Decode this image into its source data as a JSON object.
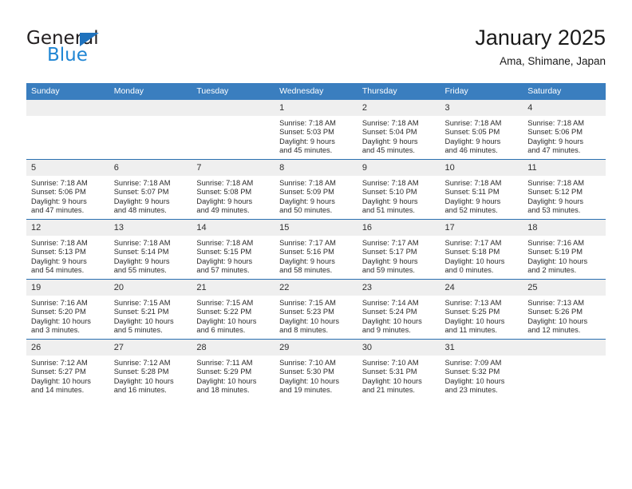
{
  "brand": {
    "name_part1": "General",
    "name_part2": "Blue",
    "triangle_color": "#1f72bd",
    "blue_color": "#2086d4"
  },
  "header": {
    "title": "January 2025",
    "subtitle": "Ama, Shimane, Japan"
  },
  "theme": {
    "header_row_bg": "#3a7ebf",
    "day_number_bg": "#efefef",
    "week_separator": "#2a6fb0"
  },
  "weekday_headers": [
    "Sunday",
    "Monday",
    "Tuesday",
    "Wednesday",
    "Thursday",
    "Friday",
    "Saturday"
  ],
  "weeks": [
    [
      {
        "day": "",
        "empty": true
      },
      {
        "day": "",
        "empty": true
      },
      {
        "day": "",
        "empty": true
      },
      {
        "day": "1",
        "sunrise": "Sunrise: 7:18 AM",
        "sunset": "Sunset: 5:03 PM",
        "daylight1": "Daylight: 9 hours",
        "daylight2": "and 45 minutes."
      },
      {
        "day": "2",
        "sunrise": "Sunrise: 7:18 AM",
        "sunset": "Sunset: 5:04 PM",
        "daylight1": "Daylight: 9 hours",
        "daylight2": "and 45 minutes."
      },
      {
        "day": "3",
        "sunrise": "Sunrise: 7:18 AM",
        "sunset": "Sunset: 5:05 PM",
        "daylight1": "Daylight: 9 hours",
        "daylight2": "and 46 minutes."
      },
      {
        "day": "4",
        "sunrise": "Sunrise: 7:18 AM",
        "sunset": "Sunset: 5:06 PM",
        "daylight1": "Daylight: 9 hours",
        "daylight2": "and 47 minutes."
      }
    ],
    [
      {
        "day": "5",
        "sunrise": "Sunrise: 7:18 AM",
        "sunset": "Sunset: 5:06 PM",
        "daylight1": "Daylight: 9 hours",
        "daylight2": "and 47 minutes."
      },
      {
        "day": "6",
        "sunrise": "Sunrise: 7:18 AM",
        "sunset": "Sunset: 5:07 PM",
        "daylight1": "Daylight: 9 hours",
        "daylight2": "and 48 minutes."
      },
      {
        "day": "7",
        "sunrise": "Sunrise: 7:18 AM",
        "sunset": "Sunset: 5:08 PM",
        "daylight1": "Daylight: 9 hours",
        "daylight2": "and 49 minutes."
      },
      {
        "day": "8",
        "sunrise": "Sunrise: 7:18 AM",
        "sunset": "Sunset: 5:09 PM",
        "daylight1": "Daylight: 9 hours",
        "daylight2": "and 50 minutes."
      },
      {
        "day": "9",
        "sunrise": "Sunrise: 7:18 AM",
        "sunset": "Sunset: 5:10 PM",
        "daylight1": "Daylight: 9 hours",
        "daylight2": "and 51 minutes."
      },
      {
        "day": "10",
        "sunrise": "Sunrise: 7:18 AM",
        "sunset": "Sunset: 5:11 PM",
        "daylight1": "Daylight: 9 hours",
        "daylight2": "and 52 minutes."
      },
      {
        "day": "11",
        "sunrise": "Sunrise: 7:18 AM",
        "sunset": "Sunset: 5:12 PM",
        "daylight1": "Daylight: 9 hours",
        "daylight2": "and 53 minutes."
      }
    ],
    [
      {
        "day": "12",
        "sunrise": "Sunrise: 7:18 AM",
        "sunset": "Sunset: 5:13 PM",
        "daylight1": "Daylight: 9 hours",
        "daylight2": "and 54 minutes."
      },
      {
        "day": "13",
        "sunrise": "Sunrise: 7:18 AM",
        "sunset": "Sunset: 5:14 PM",
        "daylight1": "Daylight: 9 hours",
        "daylight2": "and 55 minutes."
      },
      {
        "day": "14",
        "sunrise": "Sunrise: 7:18 AM",
        "sunset": "Sunset: 5:15 PM",
        "daylight1": "Daylight: 9 hours",
        "daylight2": "and 57 minutes."
      },
      {
        "day": "15",
        "sunrise": "Sunrise: 7:17 AM",
        "sunset": "Sunset: 5:16 PM",
        "daylight1": "Daylight: 9 hours",
        "daylight2": "and 58 minutes."
      },
      {
        "day": "16",
        "sunrise": "Sunrise: 7:17 AM",
        "sunset": "Sunset: 5:17 PM",
        "daylight1": "Daylight: 9 hours",
        "daylight2": "and 59 minutes."
      },
      {
        "day": "17",
        "sunrise": "Sunrise: 7:17 AM",
        "sunset": "Sunset: 5:18 PM",
        "daylight1": "Daylight: 10 hours",
        "daylight2": "and 0 minutes."
      },
      {
        "day": "18",
        "sunrise": "Sunrise: 7:16 AM",
        "sunset": "Sunset: 5:19 PM",
        "daylight1": "Daylight: 10 hours",
        "daylight2": "and 2 minutes."
      }
    ],
    [
      {
        "day": "19",
        "sunrise": "Sunrise: 7:16 AM",
        "sunset": "Sunset: 5:20 PM",
        "daylight1": "Daylight: 10 hours",
        "daylight2": "and 3 minutes."
      },
      {
        "day": "20",
        "sunrise": "Sunrise: 7:15 AM",
        "sunset": "Sunset: 5:21 PM",
        "daylight1": "Daylight: 10 hours",
        "daylight2": "and 5 minutes."
      },
      {
        "day": "21",
        "sunrise": "Sunrise: 7:15 AM",
        "sunset": "Sunset: 5:22 PM",
        "daylight1": "Daylight: 10 hours",
        "daylight2": "and 6 minutes."
      },
      {
        "day": "22",
        "sunrise": "Sunrise: 7:15 AM",
        "sunset": "Sunset: 5:23 PM",
        "daylight1": "Daylight: 10 hours",
        "daylight2": "and 8 minutes."
      },
      {
        "day": "23",
        "sunrise": "Sunrise: 7:14 AM",
        "sunset": "Sunset: 5:24 PM",
        "daylight1": "Daylight: 10 hours",
        "daylight2": "and 9 minutes."
      },
      {
        "day": "24",
        "sunrise": "Sunrise: 7:13 AM",
        "sunset": "Sunset: 5:25 PM",
        "daylight1": "Daylight: 10 hours",
        "daylight2": "and 11 minutes."
      },
      {
        "day": "25",
        "sunrise": "Sunrise: 7:13 AM",
        "sunset": "Sunset: 5:26 PM",
        "daylight1": "Daylight: 10 hours",
        "daylight2": "and 12 minutes."
      }
    ],
    [
      {
        "day": "26",
        "sunrise": "Sunrise: 7:12 AM",
        "sunset": "Sunset: 5:27 PM",
        "daylight1": "Daylight: 10 hours",
        "daylight2": "and 14 minutes."
      },
      {
        "day": "27",
        "sunrise": "Sunrise: 7:12 AM",
        "sunset": "Sunset: 5:28 PM",
        "daylight1": "Daylight: 10 hours",
        "daylight2": "and 16 minutes."
      },
      {
        "day": "28",
        "sunrise": "Sunrise: 7:11 AM",
        "sunset": "Sunset: 5:29 PM",
        "daylight1": "Daylight: 10 hours",
        "daylight2": "and 18 minutes."
      },
      {
        "day": "29",
        "sunrise": "Sunrise: 7:10 AM",
        "sunset": "Sunset: 5:30 PM",
        "daylight1": "Daylight: 10 hours",
        "daylight2": "and 19 minutes."
      },
      {
        "day": "30",
        "sunrise": "Sunrise: 7:10 AM",
        "sunset": "Sunset: 5:31 PM",
        "daylight1": "Daylight: 10 hours",
        "daylight2": "and 21 minutes."
      },
      {
        "day": "31",
        "sunrise": "Sunrise: 7:09 AM",
        "sunset": "Sunset: 5:32 PM",
        "daylight1": "Daylight: 10 hours",
        "daylight2": "and 23 minutes."
      },
      {
        "day": "",
        "empty": true
      }
    ]
  ]
}
